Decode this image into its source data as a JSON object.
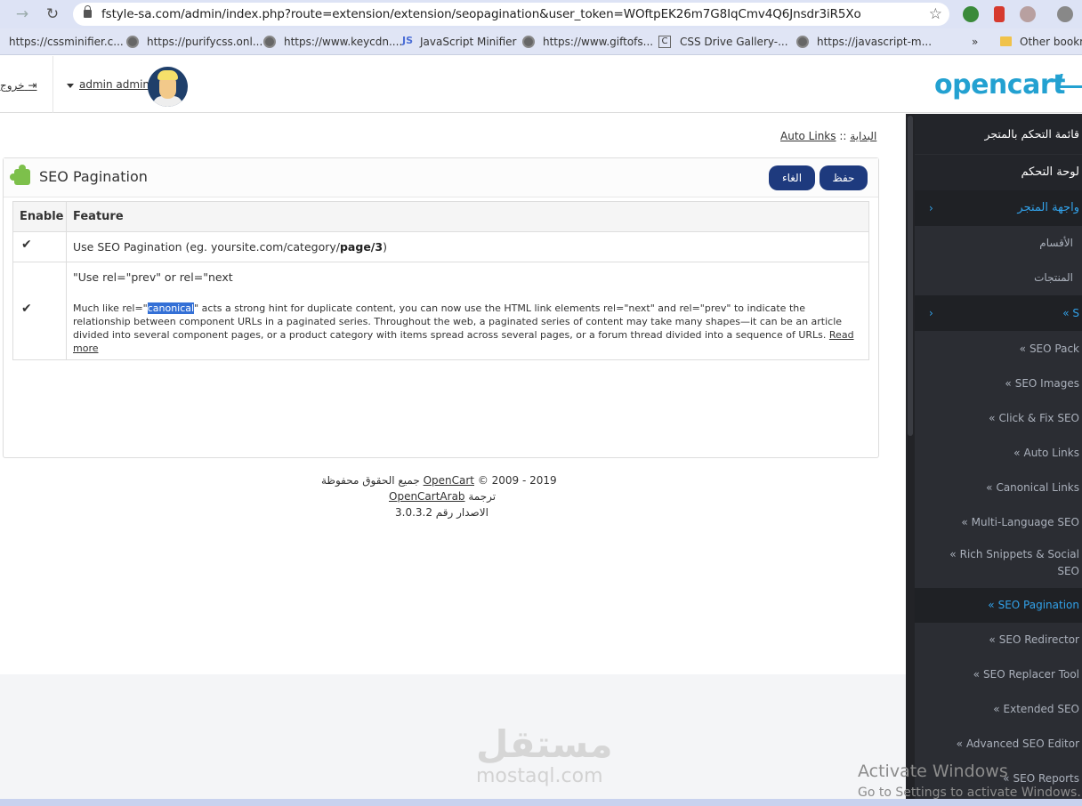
{
  "browser": {
    "url": "fstyle-sa.com/admin/index.php?route=extension/extension/seopagination&user_token=WOftpEK26m7G8IqCmv4Q6Jnsdr3iR5Xo",
    "bookmarks": [
      "https://cssminifier.c...",
      "https://purifycss.onl...",
      "https://www.keycdn....",
      "JavaScript Minifier",
      "https://www.giftofs...",
      "CSS Drive Gallery-...",
      "https://javascript-m...",
      "»",
      "Other bookm"
    ]
  },
  "header": {
    "logout": "خروج",
    "user": "admin admin",
    "logo": "opencart"
  },
  "breadcrumb": {
    "home": "البداية",
    "separator": "::",
    "current": "Auto Links"
  },
  "panel": {
    "title": "SEO Pagination",
    "save_label": "حفظ",
    "cancel_label": "الغاء"
  },
  "table": {
    "col_enable": "Enable",
    "col_feature": "Feature",
    "row1": {
      "check": "✔",
      "text_prefix": "Use SEO Pagination (eg. yoursite.com/category/",
      "text_bold": "page/3",
      "text_suffix": ")"
    },
    "row2": {
      "check": "✔",
      "title": "\"Use rel=\"prev\" or rel=\"next",
      "desc_prefix": "Much like rel=\"",
      "desc_highlight": "canonical",
      "desc_body": "\" acts a strong hint for duplicate content, you can now use the HTML link elements rel=\"next\" and rel=\"prev\" to indicate the relationship between component URLs in a paginated series. Throughout the web, a paginated series of content may take many shapes—it can be an article divided into several component pages, or a product category with items spread across several pages, or a forum thread divided into a sequence of URLs. ",
      "read_more": "Read more"
    }
  },
  "footer": {
    "rights": "جميع الحقوق محفوظة",
    "opencart": "OpenCart",
    "years": "© 2009 - 2019",
    "translation": "ترجمة",
    "opencartarab": "OpenCartArab",
    "version": "الاصدار رقم 3.0.3.2"
  },
  "sidebar": {
    "header": "قائمة التحكم بالمتجر",
    "dashboard": "لوحة التحكم",
    "storefront": "واجهة المتجر",
    "categories": "الأقسام",
    "products": "المنتجات",
    "seo_group": "S",
    "items": [
      "SEO Pack",
      "SEO Images",
      "Click & Fix SEO",
      "Auto Links",
      "Canonical Links",
      "Multi-Language SEO",
      "Rich Snippets & Social SEO",
      "SEO Pagination",
      "SEO Redirector",
      "SEO Replacer Tool",
      "Extended SEO",
      "Advanced SEO Editor",
      "SEO Reports"
    ]
  },
  "watermark": {
    "arabic": "مستقل",
    "latin": "mostaql.com"
  },
  "os": {
    "activate_title": "Activate Windows",
    "activate_sub": "Go to Settings to activate Windows."
  }
}
